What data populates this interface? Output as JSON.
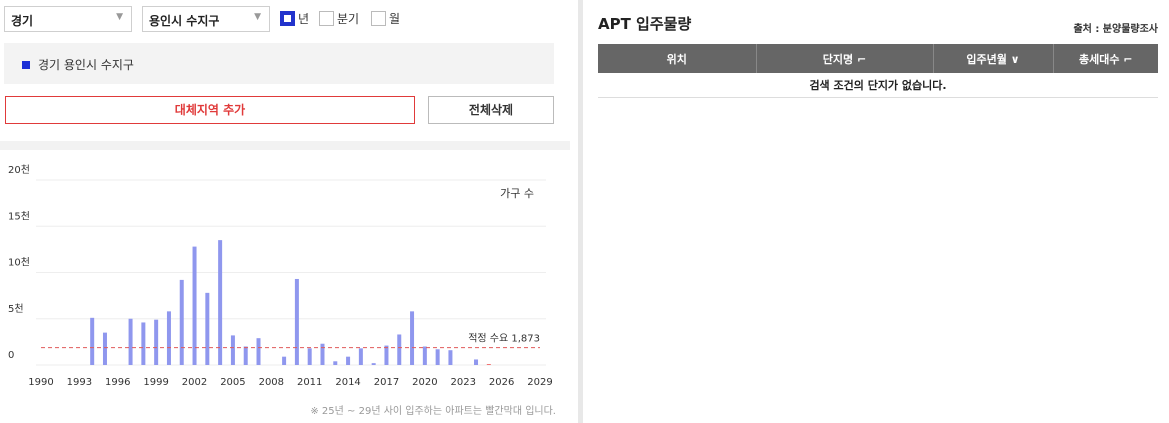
{
  "filters": {
    "province": "경기",
    "district": "용인시 수지구",
    "period_options": [
      {
        "label": "년",
        "checked": true
      },
      {
        "label": "분기",
        "checked": false
      },
      {
        "label": "월",
        "checked": false
      }
    ]
  },
  "region_list": [
    "경기 용인시 수지구"
  ],
  "buttons": {
    "add_region": "대체지역 추가",
    "delete_all": "전체삭제"
  },
  "footnote": "※ 25년 ~ 29년 사이 입주하는 아파트는 빨간막대 입니다.",
  "colors": {
    "bar": "#8f97ee",
    "bar_future": "#f06a6a",
    "reference_line": "#e05a5a",
    "accent_red": "#e03a3a",
    "check_on": "#2233cc"
  },
  "apt": {
    "title": "APT 입주물량",
    "source": "출처 : 분양물량조사",
    "columns": [
      "위치",
      "단지명 ⌐",
      "입주년월 ∨",
      "총세대수 ⌐"
    ],
    "empty_message": "검색 조건의 단지가 없습니다."
  },
  "chart_data": {
    "type": "bar",
    "legend_label": "가구 수",
    "ylim": [
      0,
      20000
    ],
    "y_ticks": [
      {
        "value": 0,
        "label": "0"
      },
      {
        "value": 5000,
        "label": "5천"
      },
      {
        "value": 10000,
        "label": "10천"
      },
      {
        "value": 15000,
        "label": "15천"
      },
      {
        "value": 20000,
        "label": "20천"
      }
    ],
    "x_range": [
      1990,
      2029
    ],
    "x_ticks": [
      1990,
      1993,
      1996,
      1999,
      2002,
      2005,
      2008,
      2011,
      2014,
      2017,
      2020,
      2023,
      2026,
      2029
    ],
    "reference_line": {
      "value": 1873,
      "label": "적정 수요 1,873"
    },
    "series": [
      {
        "x": [
          1994,
          1995,
          1997,
          1998,
          1999,
          2000,
          2001,
          2002,
          2003,
          2004,
          2005,
          2006,
          2007,
          2009,
          2010,
          2011,
          2012,
          2013,
          2014,
          2015,
          2016,
          2017,
          2018,
          2019,
          2020,
          2021,
          2022,
          2024,
          2025
        ],
        "values": [
          5100,
          3500,
          5000,
          4600,
          4900,
          5800,
          9200,
          12800,
          7800,
          13500,
          3200,
          2000,
          2900,
          900,
          9300,
          1800,
          2300,
          400,
          900,
          1800,
          200,
          2100,
          3300,
          5800,
          2000,
          1700,
          1600,
          600,
          100
        ]
      }
    ]
  }
}
